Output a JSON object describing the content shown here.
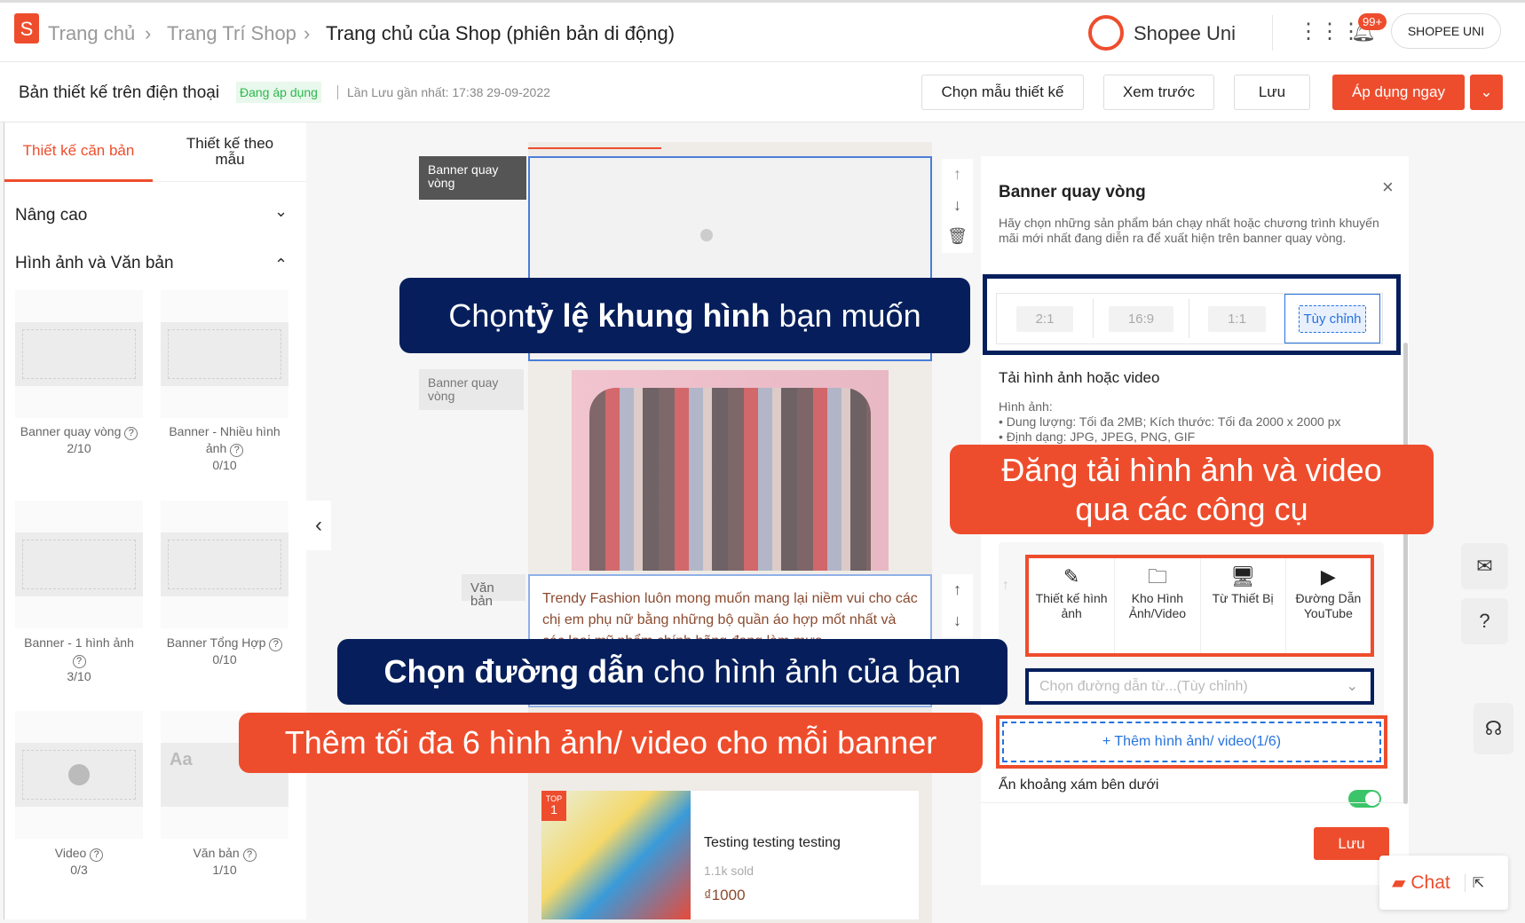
{
  "header": {
    "logo": "S",
    "breadcrumbs": [
      "Trang chủ",
      "Trang Trí Shop",
      "Trang chủ của Shop (phiên bản di động)"
    ],
    "brand": "Shopee Uni",
    "badge": "99+",
    "account": "SHOPEE UNI"
  },
  "subheader": {
    "title": "Bản thiết kế trên điện thoại",
    "status": "Đang áp dụng",
    "last_saved": "Lần Lưu gần nhất: 17:38 29-09-2022",
    "buttons": {
      "template": "Chọn mẫu thiết kế",
      "preview": "Xem trước",
      "save": "Lưu",
      "apply": "Áp dụng ngay"
    }
  },
  "sidebar": {
    "tabs": [
      "Thiết kế căn bản",
      "Thiết kế theo mẫu"
    ],
    "sections": [
      "Nâng cao",
      "Hình ảnh và Văn bản"
    ],
    "items": [
      {
        "label": "Banner quay vòng",
        "count": "2/10"
      },
      {
        "label": "Banner - Nhiều hình ảnh",
        "count": "0/10"
      },
      {
        "label": "Banner - 1 hình ảnh",
        "count": "3/10"
      },
      {
        "label": "Banner Tổng Hợp",
        "count": "0/10"
      },
      {
        "label": "Video",
        "count": "0/3"
      },
      {
        "label": "Văn bản",
        "count": "1/10",
        "thumb_text": "Aa"
      }
    ]
  },
  "canvas": {
    "labels": [
      "Banner quay vòng",
      "Banner quay vòng",
      "Văn bản"
    ],
    "text_block": "Trendy Fashion luôn mong muốn mang lại niềm vui cho các chị em phụ nữ bằng những bộ quần áo hợp mốt nhất và các loại mỹ phẩm chính hãng đang làm mưa",
    "product": {
      "badge_top": "TOP",
      "badge_rank": "1",
      "name": "Testing testing testing",
      "sold": "1.1k sold",
      "price": "₫1000"
    }
  },
  "panel": {
    "title": "Banner quay vòng",
    "desc": "Hãy chọn những sản phẩm bán chạy nhất hoặc chương trình khuyến mãi mới nhất đang diễn ra để xuất hiện trên banner quay vòng.",
    "ratios": [
      "2:1",
      "16:9",
      "1:1",
      "Tùy chỉnh"
    ],
    "upload_title": "Tải hình ảnh hoặc video",
    "upload_info": [
      "Hình ảnh:",
      "• Dung lượng: Tối đa 2MB; Kích thước: Tối đa 2000 x 2000 px",
      "• Định dạng: JPG, JPEG, PNG, GIF"
    ],
    "tools": [
      "Thiết kế hình ảnh",
      "Kho Hình Ảnh/Video",
      "Từ Thiết Bị",
      "Đường Dẫn YouTube"
    ],
    "link_placeholder": "Chọn đường dẫn từ...(Tùy chỉnh)",
    "add_media": "+ Thêm hình ảnh/ video(1/6)",
    "hide_gray": "Ẩn khoảng xám bên dưới",
    "hide_gray_on": true,
    "save": "Lưu"
  },
  "callouts": {
    "ratio": {
      "pre": "Chọn ",
      "bold": "tỷ lệ khung hình",
      "post": " bạn muốn"
    },
    "upload": "Đăng tải hình ảnh và video qua các công cụ",
    "link": {
      "bold": "Chọn đường dẫn",
      "post": " cho hình ảnh của bạn"
    },
    "max": "Thêm tối đa 6 hình ảnh/ video cho mỗi banner"
  },
  "chat": {
    "label": "Chat"
  },
  "colors": {
    "accent": "#ee4d2d",
    "navy": "#061f5c",
    "link": "#2673dd",
    "toggle": "#3cc46a"
  }
}
